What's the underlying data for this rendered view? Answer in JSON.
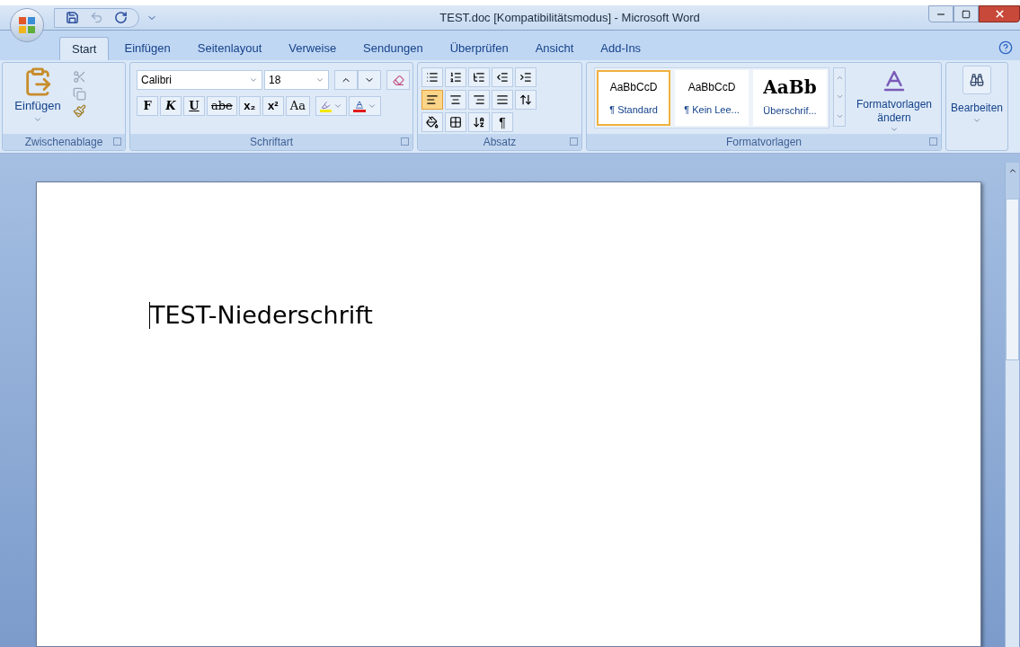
{
  "window": {
    "title": "TEST.doc [Kompatibilitätsmodus] - Microsoft Word"
  },
  "quick_access": [
    {
      "kind": "save",
      "disabled": false
    },
    {
      "kind": "undo",
      "disabled": true
    },
    {
      "kind": "redo",
      "disabled": false
    }
  ],
  "tabs": [
    {
      "label": "Start",
      "selected": true
    },
    {
      "label": "Einfügen",
      "selected": false
    },
    {
      "label": "Seitenlayout",
      "selected": false
    },
    {
      "label": "Verweise",
      "selected": false
    },
    {
      "label": "Sendungen",
      "selected": false
    },
    {
      "label": "Überprüfen",
      "selected": false
    },
    {
      "label": "Ansicht",
      "selected": false
    },
    {
      "label": "Add-Ins",
      "selected": false
    }
  ],
  "clipboard": {
    "paste_label": "Einfügen",
    "title": "Zwischenablage"
  },
  "font": {
    "family": "Calibri",
    "size": "18",
    "title": "Schriftart",
    "format_buttons": [
      {
        "kind": "bold",
        "label": "F"
      },
      {
        "kind": "italic",
        "label": "K"
      },
      {
        "kind": "underline",
        "label": "U"
      },
      {
        "kind": "strike",
        "label": "abe"
      },
      {
        "kind": "sub",
        "label": "x₂"
      },
      {
        "kind": "sup",
        "label": "x²"
      },
      {
        "kind": "case",
        "label": "Aa"
      }
    ]
  },
  "paragraph": {
    "title": "Absatz",
    "pilcrow": "¶",
    "alignments": [
      {
        "kind": "left",
        "selected": true
      },
      {
        "kind": "center",
        "selected": false
      },
      {
        "kind": "right",
        "selected": false
      },
      {
        "kind": "justify",
        "selected": false
      }
    ]
  },
  "styles": {
    "title": "Formatvorlagen",
    "change_label": "Formatvorlagen ändern",
    "items": [
      {
        "kind": "normal",
        "preview": "AaBbCcD",
        "label": "¶ Standard",
        "selected": true
      },
      {
        "kind": "normal",
        "preview": "AaBbCcD",
        "label": "¶ Kein Lee...",
        "selected": false
      },
      {
        "kind": "heading",
        "preview": "AaBb",
        "label": "Überschrif...",
        "selected": false
      }
    ]
  },
  "editing": {
    "label": "Bearbeiten"
  },
  "document": {
    "text": "TEST-Niederschrift"
  }
}
